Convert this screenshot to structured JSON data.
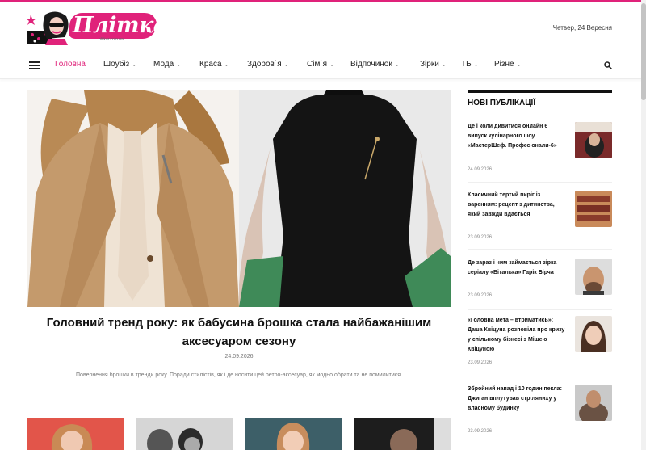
{
  "site": {
    "logo_text": "Пліткар",
    "logo_sub": "plitkar.com.ua",
    "date": "Четвер, 24 Вересня",
    "accent": "#e0227a"
  },
  "nav": {
    "items": [
      {
        "label": "Головна",
        "active": true,
        "chevron": false
      },
      {
        "label": "Шоубіз",
        "active": false,
        "chevron": true
      },
      {
        "label": "Мода",
        "active": false,
        "chevron": true
      },
      {
        "label": "Краса",
        "active": false,
        "chevron": true
      },
      {
        "label": "Здоров`я",
        "active": false,
        "chevron": true
      },
      {
        "label": "Сім`я",
        "active": false,
        "chevron": true
      },
      {
        "label": "Відпочинок",
        "active": false,
        "chevron": true
      },
      {
        "label": "Зірки",
        "active": false,
        "chevron": true
      },
      {
        "label": "ТБ",
        "active": false,
        "chevron": true
      },
      {
        "label": "Різне",
        "active": false,
        "chevron": true
      }
    ],
    "chevron_glyph": "⌄",
    "menu_icon": "hamburger-icon",
    "search_icon": "search-icon"
  },
  "hero": {
    "title": "Головний тренд року: як бабусина брошка стала найбажанішим аксесуаром сезону",
    "date": "24.09.2026",
    "excerpt": "Повернення брошки в тренди року. Поради стилістів, як і де носити цей ретро-аксесуар, як модно обрати та не помилитися."
  },
  "sidebar": {
    "title": "Нові публікації",
    "posts": [
      {
        "title": "Де і коли дивитися онлайн 6 випуск кулінарного шоу «МастерШеф. Професіонали-6»",
        "date": "24.09.2026"
      },
      {
        "title": "Класичний тертий пиріг із варенням: рецепт з дитинства, який завжди вдається",
        "date": "23.09.2026"
      },
      {
        "title": "Де зараз і чим займається зірка серіалу «Віталька» Гарік Бірча",
        "date": "23.09.2026"
      },
      {
        "title": "«Головна мета – втриматись»: Даша Квіцуна розповіла про кризу у спільному бізнесі з Мішею Квіцуною",
        "date": "23.09.2026"
      },
      {
        "title": "Збройний напад і 10 годин пекла: Джиган вплутував стріляниху у власному будинку",
        "date": "23.09.2026"
      }
    ]
  }
}
